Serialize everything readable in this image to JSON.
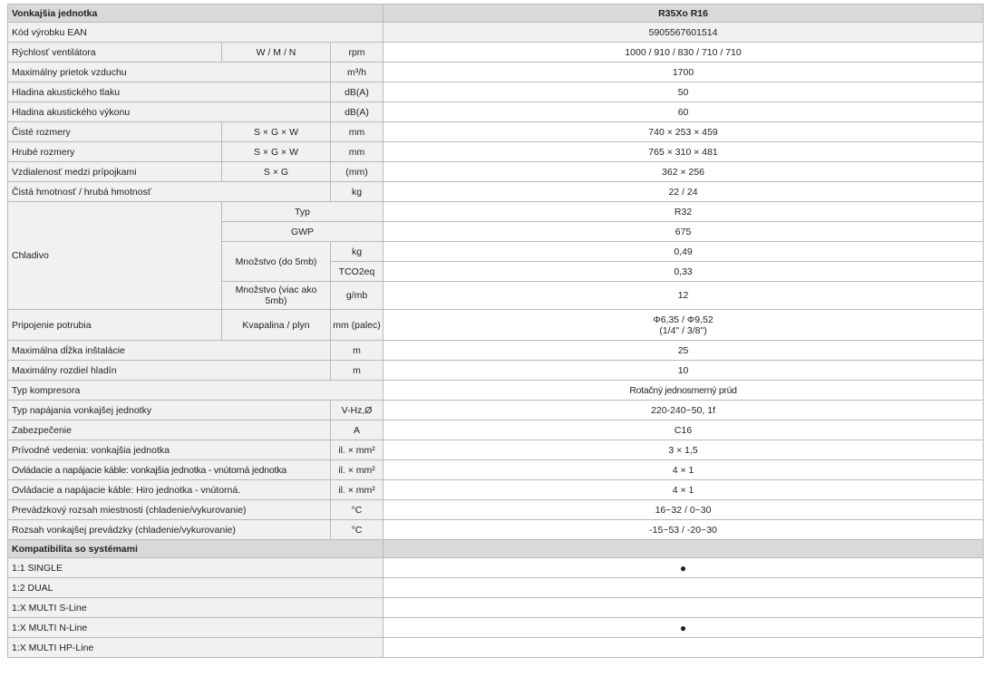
{
  "header": {
    "title": "Vonkajšia jednotka",
    "model": "R35Xo R16"
  },
  "rows": {
    "ean": {
      "label": "Kód výrobku EAN",
      "value": "5905567601514"
    },
    "fan": {
      "label": "Rýchlosť ventilátora",
      "sub": "W / M / N",
      "unit": "rpm",
      "value": "1000 / 910 / 830 / 710 / 710"
    },
    "airflow": {
      "label": "Maximálny prietok vzduchu",
      "unit": "m³/h",
      "value": "1700"
    },
    "pressure": {
      "label": "Hladina akustického tlaku",
      "unit": "dB(A)",
      "value": "50"
    },
    "power": {
      "label": "Hladina akustického výkonu",
      "unit": "dB(A)",
      "value": "60"
    },
    "net_dim": {
      "label": "Čisté rozmery",
      "sub": "S × G × W",
      "unit": "mm",
      "value": "740 × 253 × 459"
    },
    "gross_dim": {
      "label": "Hrubé rozmery",
      "sub": "S × G × W",
      "unit": "mm",
      "value": "765 × 310 × 481"
    },
    "conn_dist": {
      "label": "Vzdialenosť medzi prípojkami",
      "sub": "S × G",
      "unit": "(mm)",
      "value": "362 × 256"
    },
    "weight": {
      "label": "Čistá hmotnosť / hrubá hmotnosť",
      "unit": "kg",
      "value": "22 / 24"
    },
    "refrigerant": {
      "label": "Chladivo",
      "type_label": "Typ",
      "type_value": "R32",
      "gwp_label": "GWP",
      "gwp_value": "675",
      "qty_label": "Množstvo (do 5mb)",
      "qty_kg_unit": "kg",
      "qty_kg_value": "0,49",
      "qty_tco_unit": "TCO2eq",
      "qty_tco_value": "0,33",
      "extra_label": "Množstvo (viac ako 5mb)",
      "extra_unit": "g/mb",
      "extra_value": "12"
    },
    "piping": {
      "label": "Pripojenie potrubia",
      "sub": "Kvapalina / plyn",
      "unit": "mm (palec)",
      "value_line1": "Φ6,35 / Φ9,52",
      "value_line2": "(1/4\" / 3/8\")"
    },
    "max_len": {
      "label": "Maximálna dĺžka inštalácie",
      "unit": "m",
      "value": "25"
    },
    "max_height": {
      "label": "Maximálny rozdiel hladín",
      "unit": "m",
      "value": "10"
    },
    "compressor": {
      "label": "Typ kompresora",
      "value": "Rotačný jednosmerný prúd"
    },
    "supply": {
      "label": "Typ napájania vonkajšej jednotky",
      "unit": "V-Hz,Ø",
      "value": "220-240~50, 1f"
    },
    "fuse": {
      "label": "Zabezpečenie",
      "unit": "A",
      "value": "C16"
    },
    "leads": {
      "label": "Prívodné vedenia: vonkajšia jednotka",
      "unit": "il. × mm²",
      "value": "3 × 1,5"
    },
    "cable_ou_iu": {
      "label": "Ovládacie a napájacie káble: vonkajšia jednotka - vnútorná jednotka",
      "unit": "il. × mm²",
      "value": "4 × 1"
    },
    "cable_hiro": {
      "label": "Ovládacie a napájacie káble: Hiro jednotka - vnútorná.",
      "unit": "il. × mm²",
      "value": "4 × 1"
    },
    "range_room": {
      "label": "Prevádzkový rozsah miestnosti (chladenie/vykurovanie)",
      "unit": "°C",
      "value": "16~32 / 0~30"
    },
    "range_out": {
      "label": "Rozsah vonkajšej prevádzky (chladenie/vykurovanie)",
      "unit": "°C",
      "value": "-15~53 / -20~30"
    }
  },
  "compat": {
    "title": "Kompatibilita so systémami",
    "items": [
      {
        "label": "1:1 SINGLE",
        "value": "●"
      },
      {
        "label": "1:2 DUAL",
        "value": ""
      },
      {
        "label": "1:X MULTI S-Line",
        "value": ""
      },
      {
        "label": "1:X MULTI N-Line",
        "value": "●"
      },
      {
        "label": "1:X MULTI HP-Line",
        "value": ""
      }
    ]
  }
}
